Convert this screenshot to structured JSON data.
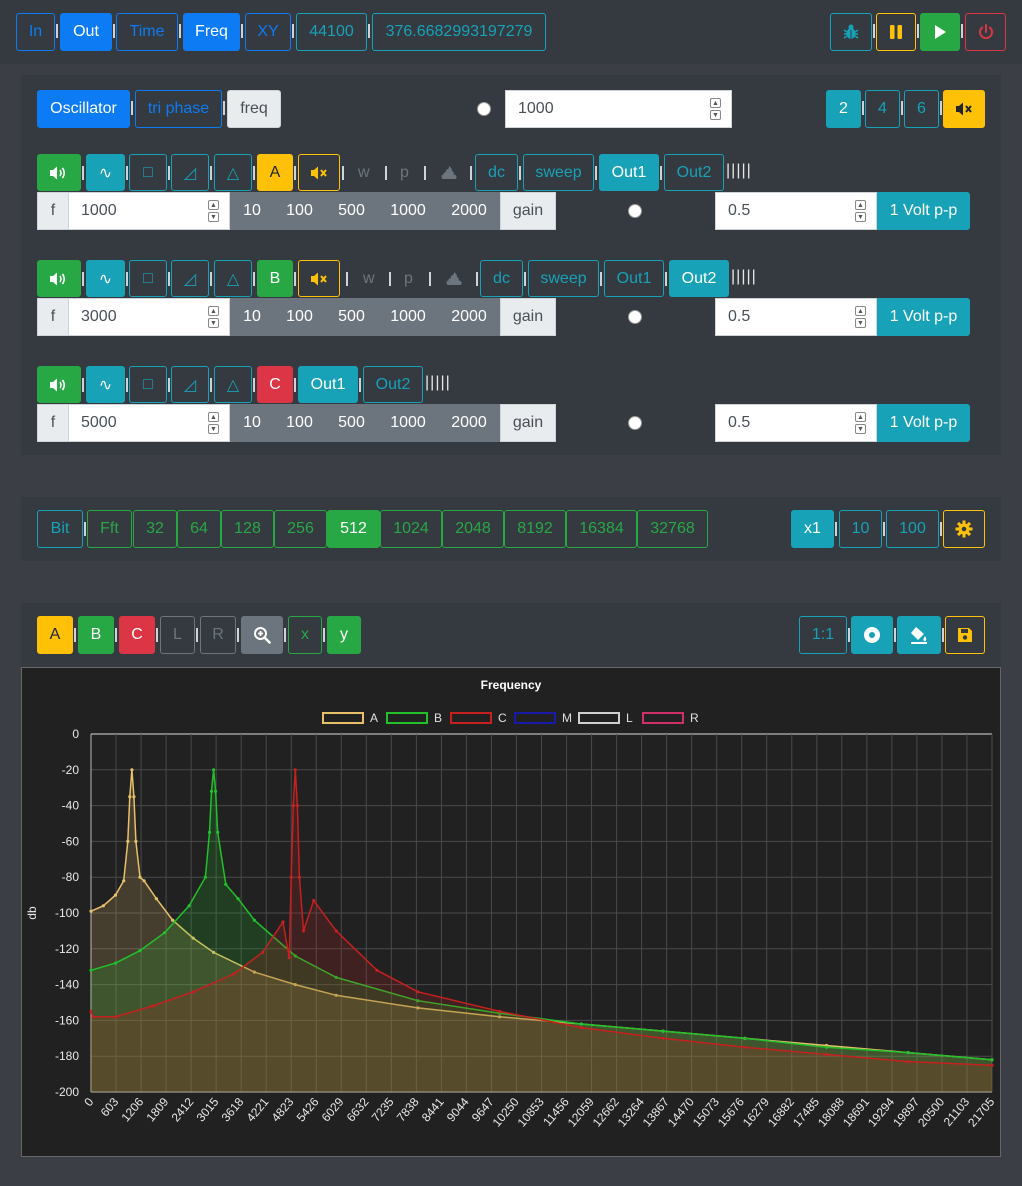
{
  "topbar": {
    "in": "In",
    "out": "Out",
    "time": "Time",
    "freq": "Freq",
    "xy": "XY",
    "sample_rate": "44100",
    "value": "376.6682993197279",
    "icons": [
      "bug-icon",
      "pause-icon",
      "play-icon",
      "power-icon"
    ]
  },
  "oscillator": {
    "tab_oscillator": "Oscillator",
    "tab_tri_phase": "tri phase",
    "tab_freq": "freq",
    "freq_value": "1000",
    "channels": [
      "2",
      "4",
      "6"
    ],
    "channels_selected": "2",
    "mute_icon": "volume-mute-icon",
    "rows": [
      {
        "label": "A",
        "label_color": "#ffc107",
        "show_mute": true,
        "show_wp": true,
        "dc": "dc",
        "sweep": "sweep",
        "out1": "Out1",
        "out2": "Out2",
        "out_selected": "Out1",
        "bars": "|||||",
        "f_label": "f",
        "f_value": "1000",
        "presets": [
          "10",
          "100",
          "500",
          "1000",
          "2000"
        ],
        "gain_label": "gain",
        "gain_value": "0.5",
        "volt": "1 Volt p-p"
      },
      {
        "label": "B",
        "label_color": "#28a745",
        "show_mute": true,
        "show_wp": true,
        "dc": "dc",
        "sweep": "sweep",
        "out1": "Out1",
        "out2": "Out2",
        "out_selected": "Out2",
        "bars": "|||||",
        "f_label": "f",
        "f_value": "3000",
        "presets": [
          "10",
          "100",
          "500",
          "1000",
          "2000"
        ],
        "gain_label": "gain",
        "gain_value": "0.5",
        "volt": "1 Volt p-p"
      },
      {
        "label": "C",
        "label_color": "#dc3545",
        "show_mute": false,
        "show_wp": false,
        "out1": "Out1",
        "out2": "Out2",
        "out_selected": "Out1",
        "bars": "|||||",
        "f_label": "f",
        "f_value": "5000",
        "presets": [
          "10",
          "100",
          "500",
          "1000",
          "2000"
        ],
        "gain_label": "gain",
        "gain_value": "0.5",
        "volt": "1 Volt p-p"
      }
    ],
    "w": "w",
    "p": "p"
  },
  "fft": {
    "bit": "Bit",
    "fft": "Fft",
    "sizes": [
      "32",
      "64",
      "128",
      "256",
      "512",
      "1024",
      "2048",
      "8192",
      "16384",
      "32768"
    ],
    "selected": "512",
    "scales": [
      "x1",
      "10",
      "100"
    ],
    "scale_selected": "x1"
  },
  "view": {
    "channels": [
      "A",
      "B",
      "C",
      "L",
      "R"
    ],
    "zoom_icon": "zoom-in-icon",
    "x": "x",
    "y": "y",
    "ratio": "1:1",
    "icons": [
      "record-icon",
      "paint-bucket-icon",
      "save-icon"
    ]
  },
  "chart_data": {
    "type": "line",
    "title": "Frequency",
    "xlabel": "",
    "ylabel": "db",
    "ylim": [
      -200,
      0
    ],
    "y_ticks": [
      0,
      -20,
      -40,
      -60,
      -80,
      -100,
      -120,
      -140,
      -160,
      -180,
      -200
    ],
    "x_ticks": [
      "0",
      "603",
      "1206",
      "1809",
      "2412",
      "3015",
      "3618",
      "4221",
      "4823",
      "5426",
      "6029",
      "6632",
      "7235",
      "7838",
      "8441",
      "9044",
      "9647",
      "10250",
      "10853",
      "11456",
      "12059",
      "12662",
      "13264",
      "13867",
      "14470",
      "15073",
      "15676",
      "16279",
      "16882",
      "17485",
      "18088",
      "18691",
      "19294",
      "19897",
      "20500",
      "21103",
      "21705"
    ],
    "xlim": [
      0,
      22050
    ],
    "legend_position": "top",
    "grid": true,
    "series": [
      {
        "name": "A",
        "color": "#e8c06a",
        "peak_x": 1000,
        "x": [
          0,
          300,
          600,
          800,
          900,
          950,
          1000,
          1050,
          1100,
          1200,
          1300,
          1600,
          2000,
          2500,
          3000,
          4000,
          5000,
          6000,
          8000,
          10000,
          12000,
          14000,
          16000,
          18000,
          20000,
          22050
        ],
        "y": [
          -99,
          -96,
          -90,
          -82,
          -60,
          -35,
          -20,
          -35,
          -60,
          -80,
          -82,
          -92,
          -104,
          -114,
          -122,
          -133,
          -140,
          -146,
          -153,
          -158,
          -162,
          -166,
          -170,
          -174,
          -178,
          -182
        ]
      },
      {
        "name": "B",
        "color": "#22c02a",
        "peak_x": 3000,
        "x": [
          0,
          600,
          1200,
          1800,
          2400,
          2800,
          2900,
          2950,
          3000,
          3050,
          3100,
          3300,
          3600,
          4000,
          5000,
          6000,
          8000,
          10000,
          12000,
          14000,
          16000,
          18000,
          20000,
          22050
        ],
        "y": [
          -132,
          -128,
          -121,
          -111,
          -96,
          -80,
          -55,
          -32,
          -20,
          -32,
          -55,
          -84,
          -92,
          -104,
          -124,
          -136,
          -149,
          -156,
          -162,
          -166,
          -170,
          -175,
          -178,
          -182
        ]
      },
      {
        "name": "C",
        "color": "#c62020",
        "peak_x": 5000,
        "x": [
          0,
          50,
          600,
          1500,
          2500,
          3500,
          4200,
          4700,
          4850,
          4900,
          4950,
          5000,
          5050,
          5100,
          5200,
          5450,
          6000,
          7000,
          8000,
          10000,
          12000,
          14000,
          16000,
          18000,
          20000,
          22050
        ],
        "y": [
          -155,
          -158,
          -158,
          -152,
          -144,
          -134,
          -122,
          -105,
          -125,
          -80,
          -40,
          -20,
          -40,
          -80,
          -110,
          -93,
          -110,
          -132,
          -144,
          -155,
          -164,
          -170,
          -175,
          -179,
          -183,
          -185
        ]
      },
      {
        "name": "M",
        "color": "#1a1aa8",
        "x": [],
        "y": []
      },
      {
        "name": "L",
        "color": "#d0d0d0",
        "x": [],
        "y": []
      },
      {
        "name": "R",
        "color": "#d0306a",
        "x": [],
        "y": []
      }
    ]
  }
}
